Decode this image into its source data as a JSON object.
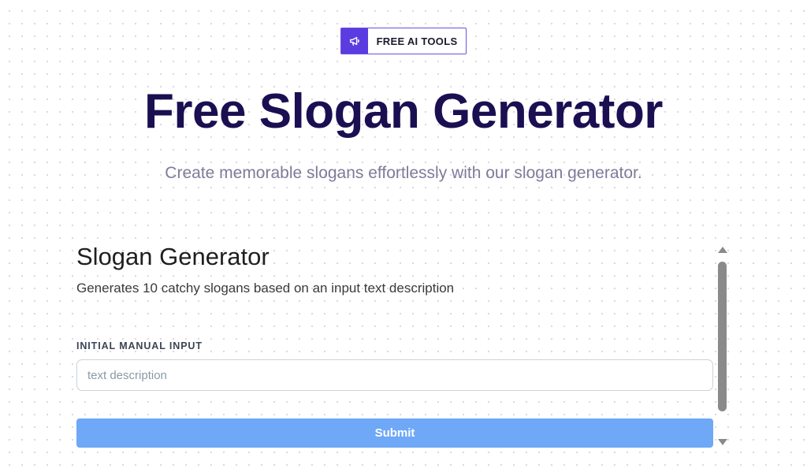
{
  "badge": {
    "icon": "megaphone-icon",
    "label": "FREE AI TOOLS"
  },
  "hero": {
    "title": "Free Slogan Generator",
    "subtitle": "Create memorable slogans effortlessly with our slogan generator."
  },
  "tool": {
    "title": "Slogan Generator",
    "description": "Generates 10 catchy slogans based on an input text description",
    "input_label": "INITIAL MANUAL INPUT",
    "input_value": "",
    "input_placeholder": "text description",
    "submit_label": "Submit"
  },
  "colors": {
    "accent": "#5b3ce0",
    "title": "#1b0f52",
    "submit": "#6ea8f7"
  }
}
